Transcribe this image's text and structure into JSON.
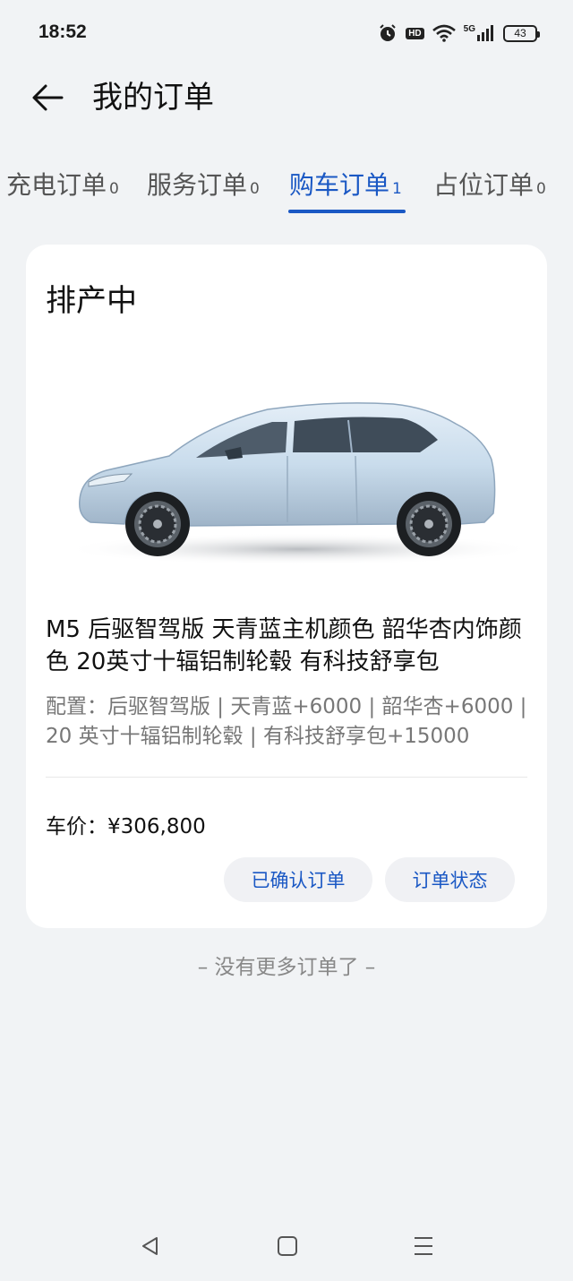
{
  "status_bar": {
    "time": "18:52",
    "signal_label": "5G",
    "hd_label": "HD",
    "battery_level": "43"
  },
  "header": {
    "title": "我的订单"
  },
  "tabs": [
    {
      "label": "充电订单",
      "count": "0",
      "active": false
    },
    {
      "label": "服务订单",
      "count": "0",
      "active": false
    },
    {
      "label": "购车订单",
      "count": "1",
      "active": true
    },
    {
      "label": "占位订单",
      "count": "0",
      "active": false
    }
  ],
  "order": {
    "status": "排产中",
    "title": "M5 后驱智驾版 天青蓝主机颜色 韶华杏内饰颜色 20英寸十辐铝制轮毂 有科技舒享包",
    "config": "配置：后驱智驾版 | 天青蓝+6000 | 韶华杏+6000 | 20 英寸十辐铝制轮毂 | 有科技舒享包+15000",
    "price": "车价：¥306,800",
    "actions": {
      "confirmed": "已确认订单",
      "status": "订单状态"
    }
  },
  "end_message": "– 没有更多订单了 –",
  "colors": {
    "accent": "#1a58c4",
    "background": "#f1f3f5",
    "card": "#ffffff",
    "car_body": "#c9dcec"
  },
  "icons": {
    "back": "arrow-left-icon",
    "nav_back": "triangle-back-icon",
    "nav_home": "square-home-icon",
    "nav_menu": "three-lines-menu-icon"
  }
}
